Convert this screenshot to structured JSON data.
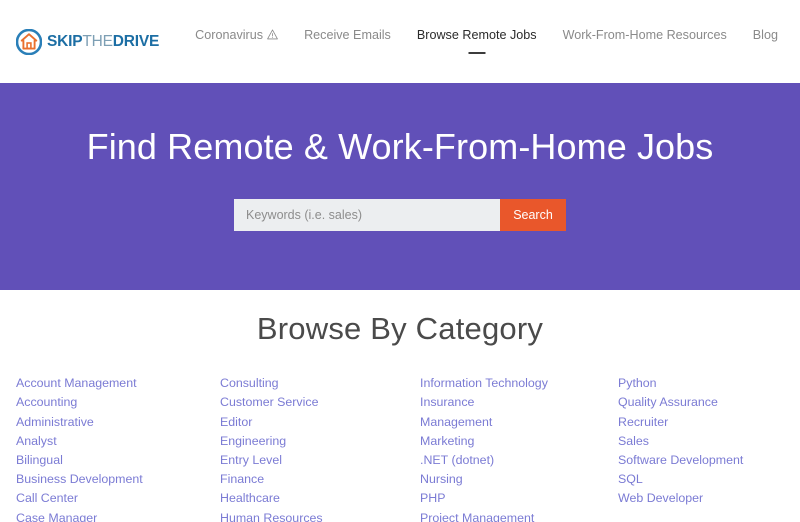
{
  "header": {
    "logo": {
      "icon": "house-in-circle-icon",
      "text_part_1": "SKIP",
      "text_part_2": "THE",
      "text_part_3": "DRIVE"
    },
    "nav_items": [
      {
        "label": "Coronavirus",
        "icon": "warning-triangle-icon",
        "active": false
      },
      {
        "label": "Receive Emails",
        "icon": null,
        "active": false
      },
      {
        "label": "Browse Remote Jobs",
        "icon": null,
        "active": true
      },
      {
        "label": "Work-From-Home Resources",
        "icon": null,
        "active": false
      },
      {
        "label": "Blog",
        "icon": null,
        "active": false
      }
    ]
  },
  "hero": {
    "title": "Find Remote & Work-From-Home Jobs",
    "background_color": "#6150b8",
    "search": {
      "placeholder": "Keywords (i.e. sales)",
      "value": "",
      "button_label": "Search",
      "button_color": "#e9572b"
    }
  },
  "categories": {
    "title": "Browse By Category",
    "link_color": "#7b7bd4",
    "columns": [
      {
        "items": [
          "Account Management",
          "Accounting",
          "Administrative",
          "Analyst",
          "Bilingual",
          "Business Development",
          "Call Center",
          "Case Manager"
        ]
      },
      {
        "items": [
          "Consulting",
          "Customer Service",
          "Editor",
          "Engineering",
          "Entry Level",
          "Finance",
          "Healthcare",
          "Human Resources"
        ]
      },
      {
        "items": [
          "Information Technology",
          "Insurance",
          "Management",
          "Marketing",
          ".NET (dotnet)",
          "Nursing",
          "PHP",
          "Project Management"
        ]
      },
      {
        "items": [
          "Python",
          "Quality Assurance",
          "Recruiter",
          "Sales",
          "Software Development",
          "SQL",
          "Web Developer"
        ]
      }
    ]
  }
}
